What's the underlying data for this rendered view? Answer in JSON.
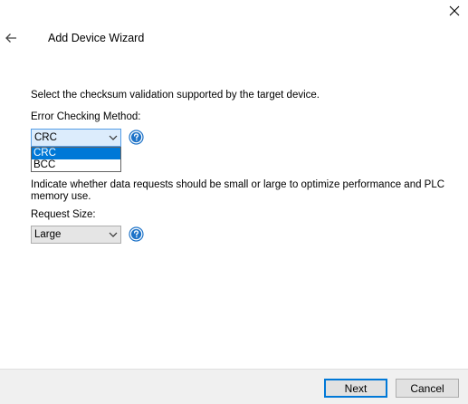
{
  "window": {
    "title": "Add Device Wizard",
    "close_icon": "close-icon",
    "back_icon": "back-arrow-icon"
  },
  "checksum": {
    "instruction": "Select the checksum validation supported by the target device.",
    "label": "Error Checking Method:",
    "selected": "CRC",
    "options": [
      "CRC",
      "BCC"
    ],
    "highlighted_option": "CRC",
    "help_icon": "help-icon"
  },
  "request": {
    "instruction_line1": "Indicate whether data requests should be small or large to optimize performance and PLC",
    "instruction_line2": "memory use.",
    "label": "Request Size:",
    "selected": "Large",
    "help_icon": "help-icon"
  },
  "footer": {
    "next_label": "Next",
    "cancel_label": "Cancel"
  },
  "colors": {
    "selection": "#0078d7",
    "help_icon": "#1e73c8",
    "footer_bg": "#f0f0f0"
  }
}
